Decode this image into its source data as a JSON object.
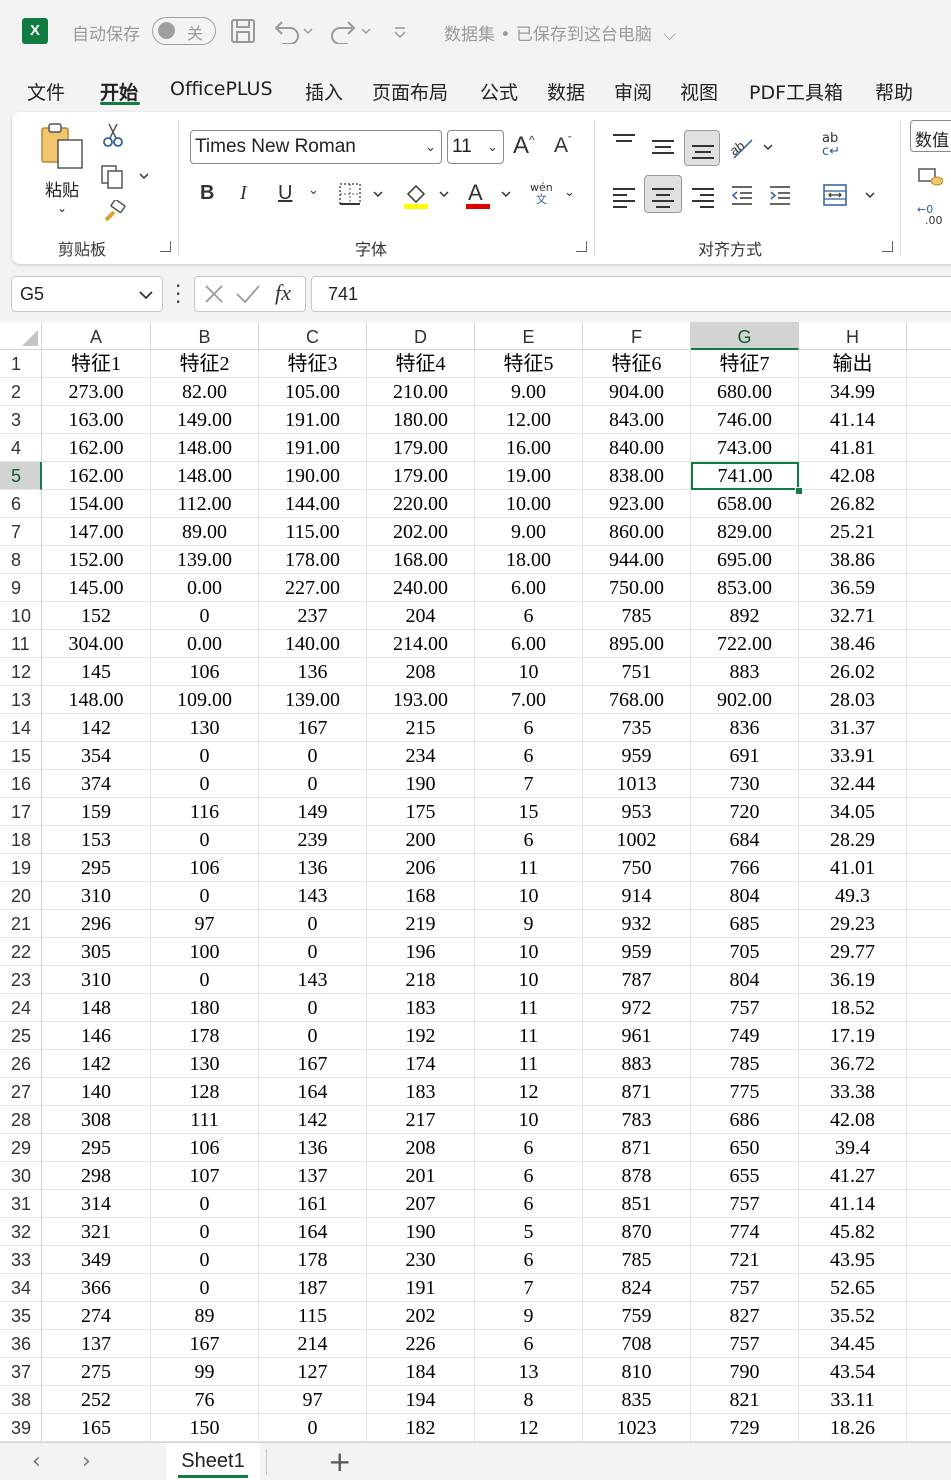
{
  "titlebar": {
    "app_icon": "X",
    "autosave_label": "自动保存",
    "autosave_toggle": "关",
    "doc_title": "数据集 • 已保存到这台电脑",
    "chevron": "⌵"
  },
  "menu": [
    {
      "label": "文件"
    },
    {
      "label": "开始"
    },
    {
      "label": "OfficePLUS"
    },
    {
      "label": "插入"
    },
    {
      "label": "页面布局"
    },
    {
      "label": "公式"
    },
    {
      "label": "数据"
    },
    {
      "label": "审阅"
    },
    {
      "label": "视图"
    },
    {
      "label": "PDF工具箱"
    },
    {
      "label": "帮助"
    }
  ],
  "ribbon": {
    "clipboard": {
      "group_label": "剪贴板",
      "paste_label": "粘贴"
    },
    "font": {
      "group_label": "字体",
      "font_name": "Times New Roman",
      "font_size": "11",
      "bold": "B",
      "italic": "I",
      "underline": "U",
      "phonetic_top": "wén",
      "phonetic_bottom": "文",
      "highlight_color": "#ffff00",
      "font_color": "#e00000"
    },
    "alignment": {
      "group_label": "对齐方式"
    },
    "number": {
      "format": "数值"
    }
  },
  "formula_bar": {
    "name_box": "G5",
    "fx": "fx",
    "value": "741"
  },
  "grid": {
    "columns": [
      "A",
      "B",
      "C",
      "D",
      "E",
      "F",
      "G",
      "H"
    ],
    "selected_column": "G",
    "selected_row": "5",
    "rows": [
      {
        "n": "1",
        "c": [
          "特征1",
          "特征2",
          "特征3",
          "特征4",
          "特征5",
          "特征6",
          "特征7",
          "输出"
        ]
      },
      {
        "n": "2",
        "c": [
          "273.00",
          "82.00",
          "105.00",
          "210.00",
          "9.00",
          "904.00",
          "680.00",
          "34.99"
        ]
      },
      {
        "n": "3",
        "c": [
          "163.00",
          "149.00",
          "191.00",
          "180.00",
          "12.00",
          "843.00",
          "746.00",
          "41.14"
        ]
      },
      {
        "n": "4",
        "c": [
          "162.00",
          "148.00",
          "191.00",
          "179.00",
          "16.00",
          "840.00",
          "743.00",
          "41.81"
        ]
      },
      {
        "n": "5",
        "c": [
          "162.00",
          "148.00",
          "190.00",
          "179.00",
          "19.00",
          "838.00",
          "741.00",
          "42.08"
        ]
      },
      {
        "n": "6",
        "c": [
          "154.00",
          "112.00",
          "144.00",
          "220.00",
          "10.00",
          "923.00",
          "658.00",
          "26.82"
        ]
      },
      {
        "n": "7",
        "c": [
          "147.00",
          "89.00",
          "115.00",
          "202.00",
          "9.00",
          "860.00",
          "829.00",
          "25.21"
        ]
      },
      {
        "n": "8",
        "c": [
          "152.00",
          "139.00",
          "178.00",
          "168.00",
          "18.00",
          "944.00",
          "695.00",
          "38.86"
        ]
      },
      {
        "n": "9",
        "c": [
          "145.00",
          "0.00",
          "227.00",
          "240.00",
          "6.00",
          "750.00",
          "853.00",
          "36.59"
        ]
      },
      {
        "n": "10",
        "c": [
          "152",
          "0",
          "237",
          "204",
          "6",
          "785",
          "892",
          "32.71"
        ]
      },
      {
        "n": "11",
        "c": [
          "304.00",
          "0.00",
          "140.00",
          "214.00",
          "6.00",
          "895.00",
          "722.00",
          "38.46"
        ]
      },
      {
        "n": "12",
        "c": [
          "145",
          "106",
          "136",
          "208",
          "10",
          "751",
          "883",
          "26.02"
        ]
      },
      {
        "n": "13",
        "c": [
          "148.00",
          "109.00",
          "139.00",
          "193.00",
          "7.00",
          "768.00",
          "902.00",
          "28.03"
        ]
      },
      {
        "n": "14",
        "c": [
          "142",
          "130",
          "167",
          "215",
          "6",
          "735",
          "836",
          "31.37"
        ]
      },
      {
        "n": "15",
        "c": [
          "354",
          "0",
          "0",
          "234",
          "6",
          "959",
          "691",
          "33.91"
        ]
      },
      {
        "n": "16",
        "c": [
          "374",
          "0",
          "0",
          "190",
          "7",
          "1013",
          "730",
          "32.44"
        ]
      },
      {
        "n": "17",
        "c": [
          "159",
          "116",
          "149",
          "175",
          "15",
          "953",
          "720",
          "34.05"
        ]
      },
      {
        "n": "18",
        "c": [
          "153",
          "0",
          "239",
          "200",
          "6",
          "1002",
          "684",
          "28.29"
        ]
      },
      {
        "n": "19",
        "c": [
          "295",
          "106",
          "136",
          "206",
          "11",
          "750",
          "766",
          "41.01"
        ]
      },
      {
        "n": "20",
        "c": [
          "310",
          "0",
          "143",
          "168",
          "10",
          "914",
          "804",
          "49.3"
        ]
      },
      {
        "n": "21",
        "c": [
          "296",
          "97",
          "0",
          "219",
          "9",
          "932",
          "685",
          "29.23"
        ]
      },
      {
        "n": "22",
        "c": [
          "305",
          "100",
          "0",
          "196",
          "10",
          "959",
          "705",
          "29.77"
        ]
      },
      {
        "n": "23",
        "c": [
          "310",
          "0",
          "143",
          "218",
          "10",
          "787",
          "804",
          "36.19"
        ]
      },
      {
        "n": "24",
        "c": [
          "148",
          "180",
          "0",
          "183",
          "11",
          "972",
          "757",
          "18.52"
        ]
      },
      {
        "n": "25",
        "c": [
          "146",
          "178",
          "0",
          "192",
          "11",
          "961",
          "749",
          "17.19"
        ]
      },
      {
        "n": "26",
        "c": [
          "142",
          "130",
          "167",
          "174",
          "11",
          "883",
          "785",
          "36.72"
        ]
      },
      {
        "n": "27",
        "c": [
          "140",
          "128",
          "164",
          "183",
          "12",
          "871",
          "775",
          "33.38"
        ]
      },
      {
        "n": "28",
        "c": [
          "308",
          "111",
          "142",
          "217",
          "10",
          "783",
          "686",
          "42.08"
        ]
      },
      {
        "n": "29",
        "c": [
          "295",
          "106",
          "136",
          "208",
          "6",
          "871",
          "650",
          "39.4"
        ]
      },
      {
        "n": "30",
        "c": [
          "298",
          "107",
          "137",
          "201",
          "6",
          "878",
          "655",
          "41.27"
        ]
      },
      {
        "n": "31",
        "c": [
          "314",
          "0",
          "161",
          "207",
          "6",
          "851",
          "757",
          "41.14"
        ]
      },
      {
        "n": "32",
        "c": [
          "321",
          "0",
          "164",
          "190",
          "5",
          "870",
          "774",
          "45.82"
        ]
      },
      {
        "n": "33",
        "c": [
          "349",
          "0",
          "178",
          "230",
          "6",
          "785",
          "721",
          "43.95"
        ]
      },
      {
        "n": "34",
        "c": [
          "366",
          "0",
          "187",
          "191",
          "7",
          "824",
          "757",
          "52.65"
        ]
      },
      {
        "n": "35",
        "c": [
          "274",
          "89",
          "115",
          "202",
          "9",
          "759",
          "827",
          "35.52"
        ]
      },
      {
        "n": "36",
        "c": [
          "137",
          "167",
          "214",
          "226",
          "6",
          "708",
          "757",
          "34.45"
        ]
      },
      {
        "n": "37",
        "c": [
          "275",
          "99",
          "127",
          "184",
          "13",
          "810",
          "790",
          "43.54"
        ]
      },
      {
        "n": "38",
        "c": [
          "252",
          "76",
          "97",
          "194",
          "8",
          "835",
          "821",
          "33.11"
        ]
      },
      {
        "n": "39",
        "c": [
          "165",
          "150",
          "0",
          "182",
          "12",
          "1023",
          "729",
          "18.26"
        ]
      }
    ]
  },
  "sheets": {
    "active": "Sheet1",
    "prev_arrow": "‹",
    "next_arrow": "›",
    "add": "+"
  }
}
